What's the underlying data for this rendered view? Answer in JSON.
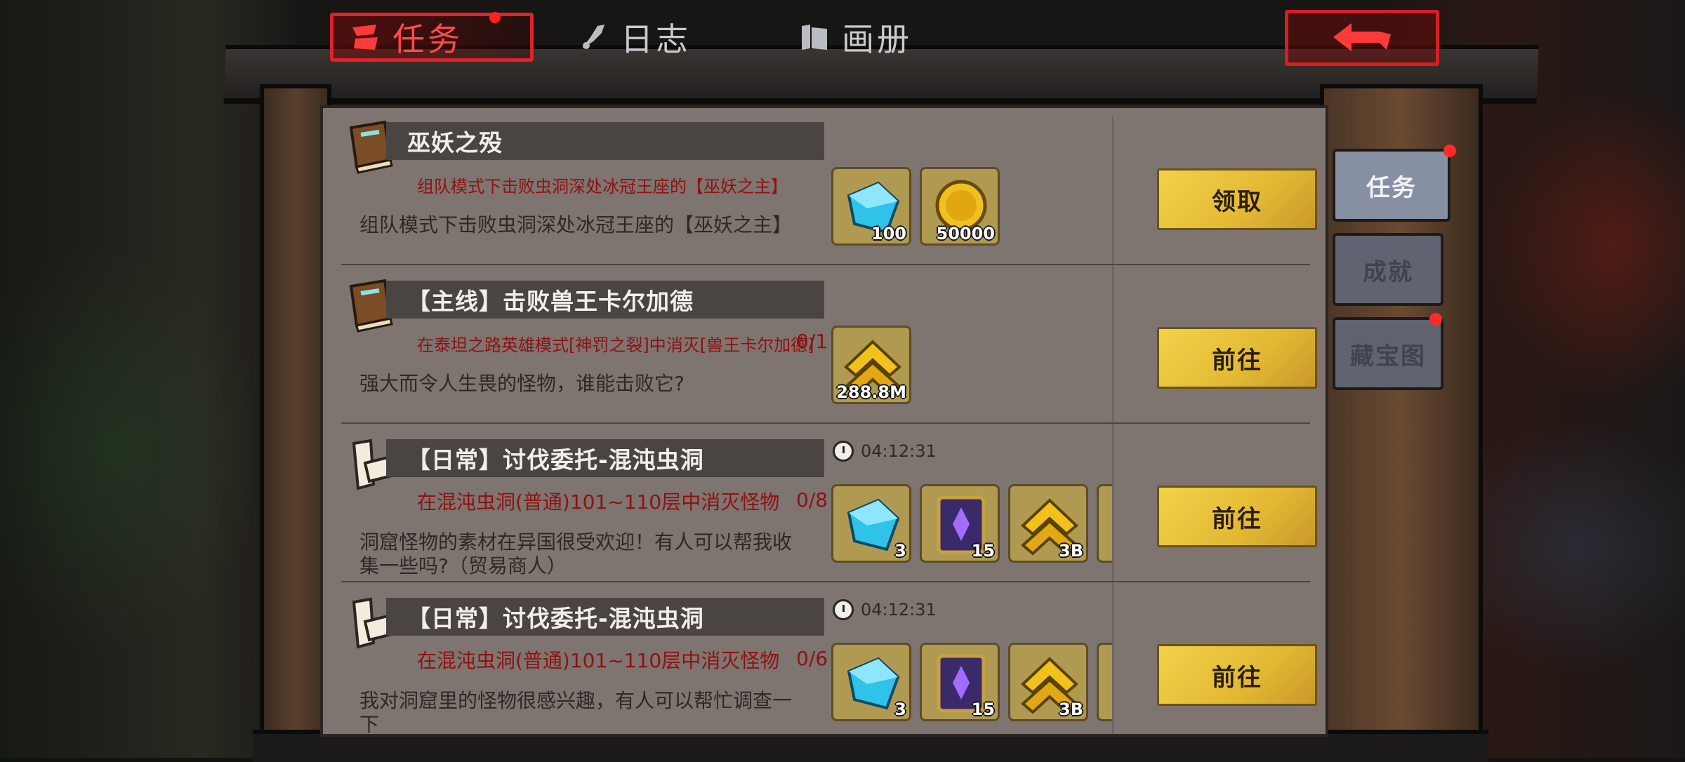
{
  "top_tabs": [
    {
      "label": "任务",
      "active": true,
      "has_alert": true
    },
    {
      "label": "日志",
      "active": false
    },
    {
      "label": "画册",
      "active": false
    }
  ],
  "side_tabs": [
    {
      "label": "任务",
      "active": true,
      "has_alert": true
    },
    {
      "label": "成就",
      "active": false
    },
    {
      "label": "藏宝图",
      "active": false,
      "has_alert": true
    }
  ],
  "quests": [
    {
      "icon": "book-icon",
      "title": "巫妖之殁",
      "objective": "组队模式下击败虫洞深处冰冠王座的【巫妖之主】",
      "progress": "",
      "description": "组队模式下击败虫洞深处冰冠王座的【巫妖之主】",
      "timer": "",
      "rewards": [
        {
          "icon": "crystal-icon",
          "count": "100"
        },
        {
          "icon": "gold-coin-icon",
          "count": "50000"
        }
      ],
      "action": "领取"
    },
    {
      "icon": "book-icon",
      "title": "【主线】击败兽王卡尔加德",
      "objective": "在泰坦之路英雄模式[神罚之裂]中消灭[兽王卡尔加德]",
      "progress": "0/1",
      "description": "强大而令人生畏的怪物，谁能击败它?",
      "timer": "",
      "rewards": [
        {
          "icon": "exp-chevron-icon",
          "count": "288.8M"
        }
      ],
      "action": "前往"
    },
    {
      "icon": "scroll-icon",
      "title": "【日常】讨伐委托-混沌虫洞",
      "objective": "在混沌虫洞(普通)101~110层中消灭怪物",
      "progress": "0/8",
      "description": "洞窟怪物的素材在异国很受欢迎！有人可以帮我收集一些吗?（贸易商人）",
      "timer": "04:12:31",
      "rewards": [
        {
          "icon": "crystal-icon",
          "count": "3"
        },
        {
          "icon": "purple-tome-icon",
          "count": "15"
        },
        {
          "icon": "exp-chevron-icon",
          "count": "3B"
        },
        {
          "icon": "reward-item-icon",
          "count": ""
        }
      ],
      "action": "前往"
    },
    {
      "icon": "scroll-icon",
      "title": "【日常】讨伐委托-混沌虫洞",
      "objective": "在混沌虫洞(普通)101~110层中消灭怪物",
      "progress": "0/6",
      "description": "我对洞窟里的怪物很感兴趣，有人可以帮忙调查一下",
      "timer": "04:12:31",
      "rewards": [
        {
          "icon": "crystal-icon",
          "count": "3"
        },
        {
          "icon": "purple-tome-icon",
          "count": "15"
        },
        {
          "icon": "exp-chevron-icon",
          "count": "3B"
        },
        {
          "icon": "reward-item-icon",
          "count": ""
        }
      ],
      "action": "前往"
    }
  ]
}
